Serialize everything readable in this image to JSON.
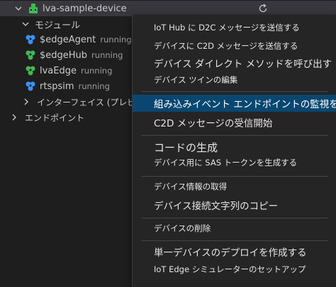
{
  "tree": {
    "device": {
      "label": "lva-sample-device"
    },
    "modules": {
      "label": "モジュール",
      "items": [
        {
          "name": "$edgeAgent",
          "status": "running",
          "color": "#3794ff"
        },
        {
          "name": "$edgeHub",
          "status": "running",
          "color": "#3fb950"
        },
        {
          "name": "lvaEdge",
          "status": "running",
          "color": "#3fb950"
        },
        {
          "name": "rtspsim",
          "status": "running",
          "color": "#3794ff"
        }
      ]
    },
    "interfaces": {
      "label": "インターフェイス (プレビュー)"
    },
    "endpoints": {
      "label": "エンドポイント"
    }
  },
  "menu": {
    "items": [
      {
        "label": "IoT Hub に D2C メッセージを送信する"
      },
      {
        "label": "デバイスに C2D メッセージを送信する"
      },
      {
        "label": "デバイス ダイレクト メソッドを呼び出す"
      },
      {
        "label": "デバイス ツインの編集"
      },
      {
        "label": "組み込みイベント エンドポイントの監視を開"
      },
      {
        "label": "C2D メッセージの受信開始"
      },
      {
        "label": "コードの生成"
      },
      {
        "label": "デバイス用に SAS トークンを生成する"
      },
      {
        "label": "デバイス情報の取得"
      },
      {
        "label": "デバイス接続文字列のコピー"
      },
      {
        "label": "デバイスの削除"
      },
      {
        "label": "単一デバイスのデプロイを作成する"
      },
      {
        "label": "IoT Edge シミュレーターのセットアップ"
      }
    ]
  },
  "colors": {
    "highlight": "#094771",
    "background": "#1e1e1e",
    "menu_bg": "#252526",
    "device_green": "#3fb950",
    "module_blue": "#3794ff"
  }
}
